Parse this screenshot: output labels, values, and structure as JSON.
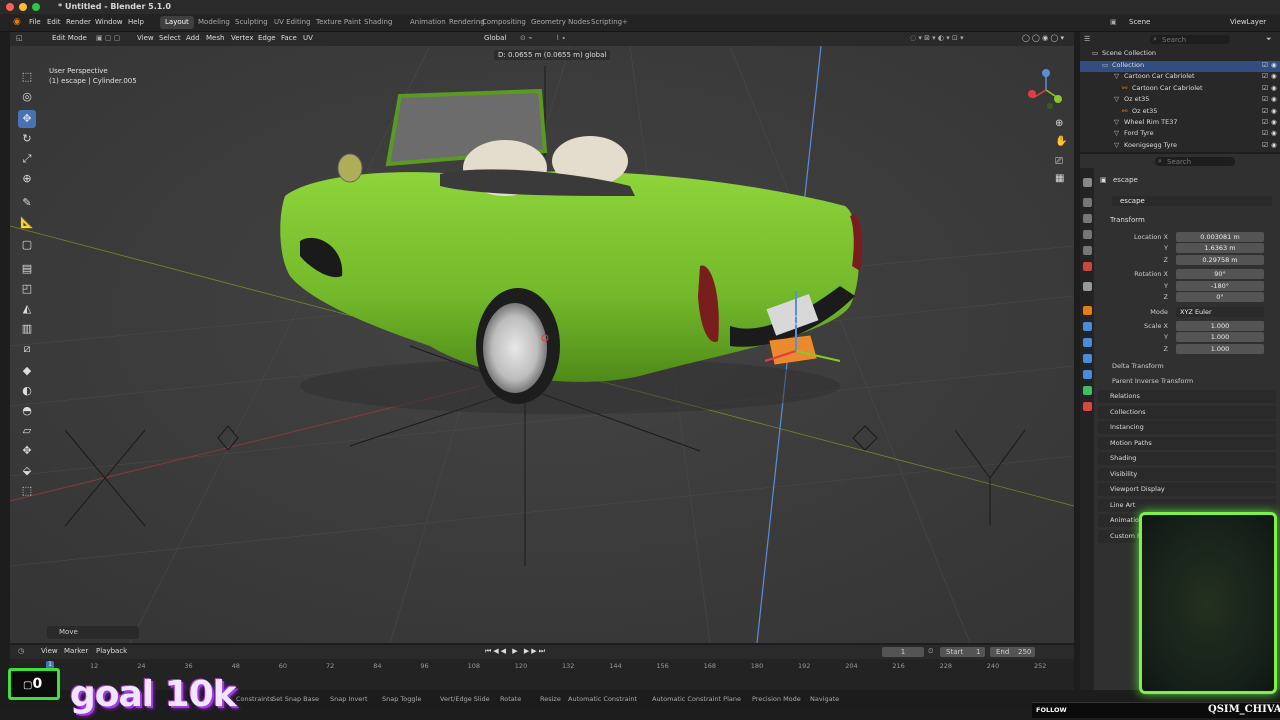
{
  "window": {
    "title": "* Untitled - Blender 5.1.0"
  },
  "menu": {
    "file": "File",
    "edit": "Edit",
    "render": "Render",
    "window": "Window",
    "help": "Help"
  },
  "workspaces": [
    "Layout",
    "Modeling",
    "Sculpting",
    "UV Editing",
    "Texture Paint",
    "Shading",
    "Animation",
    "Rendering",
    "Compositing",
    "Geometry Nodes",
    "Scripting"
  ],
  "active_workspace": "Layout",
  "scene": {
    "label": "Scene",
    "viewlayer": "ViewLayer"
  },
  "viewport_header": {
    "mode": "Edit Mode",
    "view": "View",
    "select": "Select",
    "add": "Add",
    "mesh": "Mesh",
    "vertex": "Vertex",
    "edge": "Edge",
    "face": "Face",
    "uv": "UV",
    "orientation": "Global"
  },
  "viewport": {
    "delta_readout": "D:  0.0655 m (0.0655 m) global",
    "perspective": "User Perspective",
    "object_info": "(1) escape | Cylinder.005",
    "last_op": "Move"
  },
  "outliner": {
    "search_placeholder": "Search",
    "root": "Scene Collection",
    "items": [
      {
        "label": "Collection"
      },
      {
        "label": "Cartoon Car Cabriolet"
      },
      {
        "label": "Cartoon Car Cabriolet"
      },
      {
        "label": "Oz et35"
      },
      {
        "label": "Oz et35"
      },
      {
        "label": "Wheel Rim TE37"
      },
      {
        "label": "Ford Tyre"
      },
      {
        "label": "Koenigsegg Tyre"
      }
    ]
  },
  "properties": {
    "search_placeholder": "Search",
    "object_name": "escape",
    "object_field": "escape",
    "transform_label": "Transform",
    "location_label": "Location X",
    "location": {
      "x": "0.003081 m",
      "y": "1.6363 m",
      "z": "0.29758 m"
    },
    "rotation_label": "Rotation X",
    "rotation": {
      "x": "90°",
      "y": "-180°",
      "z": "0°"
    },
    "mode_label": "Mode",
    "mode_value": "XYZ Euler",
    "scale_label": "Scale X",
    "scale": {
      "x": "1.000",
      "y": "1.000",
      "z": "1.000"
    },
    "axis_y": "Y",
    "axis_z": "Z",
    "subsections": [
      "Delta Transform",
      "Parent Inverse Transform"
    ],
    "sections": [
      "Relations",
      "Collections",
      "Instancing",
      "Motion Paths",
      "Shading",
      "Visibility",
      "Viewport Display",
      "Line Art",
      "Animation",
      "Custom Properties"
    ]
  },
  "timeline": {
    "view": "View",
    "marker": "Marker",
    "playback": "Playback",
    "current_frame": "1",
    "start_label": "Start",
    "start": "1",
    "end_label": "End",
    "end": "250",
    "ticks": [
      "12",
      "24",
      "36",
      "48",
      "60",
      "72",
      "84",
      "96",
      "108",
      "120",
      "132",
      "144",
      "156",
      "168",
      "180",
      "192",
      "204",
      "216",
      "228",
      "240",
      "252"
    ],
    "cursor_frame": "1"
  },
  "statusbar": {
    "items": [
      "Constraints",
      "Set Snap Base",
      "Snap Invert",
      "Snap Toggle",
      "Vert/Edge Slide",
      "Rotate",
      "Resize",
      "Automatic Constraint",
      "Automatic Constraint Plane",
      "Precision Mode",
      "Navigate"
    ]
  },
  "stream_overlay": {
    "counter": "0",
    "goal": "goal 10k",
    "follow": "FOLLOW",
    "name": "QSIM_CHIVA"
  },
  "colors": {
    "accent": "#4772b3",
    "car_green": "#7cc232",
    "overlay_green": "#7df04a",
    "goal_purple": "#a23be0"
  }
}
